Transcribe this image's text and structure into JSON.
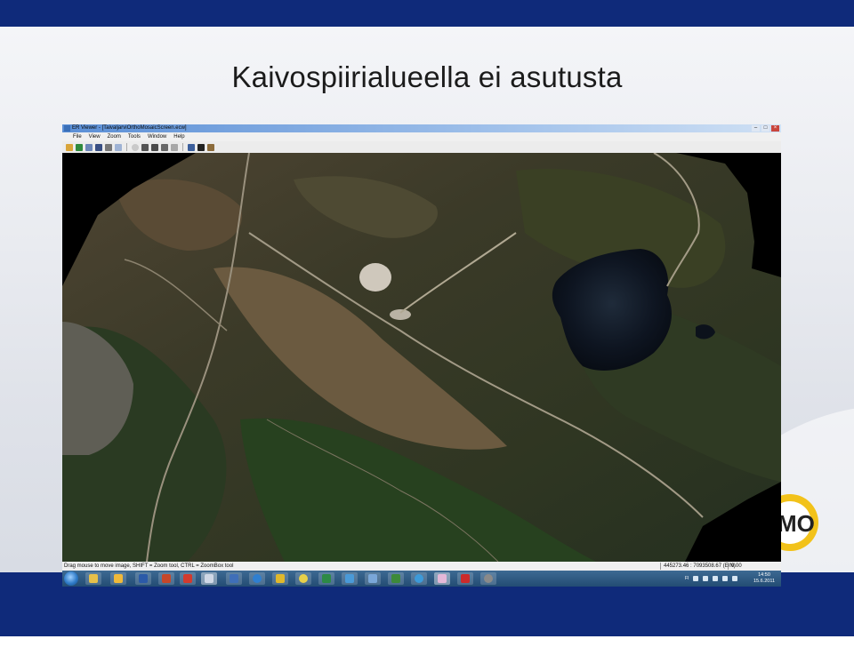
{
  "slide": {
    "title": "Kaivospiirialueella ei asutusta",
    "logo_text": "MO"
  },
  "viewer": {
    "window_title": "ER Viewer - [TaivaljarviOrthoMosaicScreen.ecw]",
    "menu": [
      "File",
      "View",
      "Zoom",
      "Tools",
      "Window",
      "Help"
    ],
    "toolbar_icons": [
      "open-icon",
      "open-folder-icon",
      "copy-icon",
      "save-icon",
      "print-icon",
      "copy-image-icon",
      "pan-icon",
      "zoom-icon",
      "zoom-in-icon",
      "zoom-out-icon",
      "zoom-box-icon",
      "info-icon",
      "pointer-icon",
      "measure-icon"
    ],
    "status": {
      "message": "Drag mouse to move image, SHIFT = Zoom tool, CTRL = ZoomBox tool",
      "coordinates": "445273.46 : 7093508.67 (E/N)",
      "zoom": "0.00"
    },
    "taskbar": {
      "apps": [
        "explorer",
        "folder",
        "word",
        "powerpoint",
        "pdf-tool",
        "charts",
        "vpn",
        "browser",
        "arrow-app",
        "ie-alt",
        "excel",
        "messenger",
        "notepad",
        "media-player",
        "ie",
        "viewer",
        "acrobat",
        "gimp"
      ],
      "tray_lang": "FI",
      "time": "14:50",
      "date": "15.6.2011"
    }
  }
}
